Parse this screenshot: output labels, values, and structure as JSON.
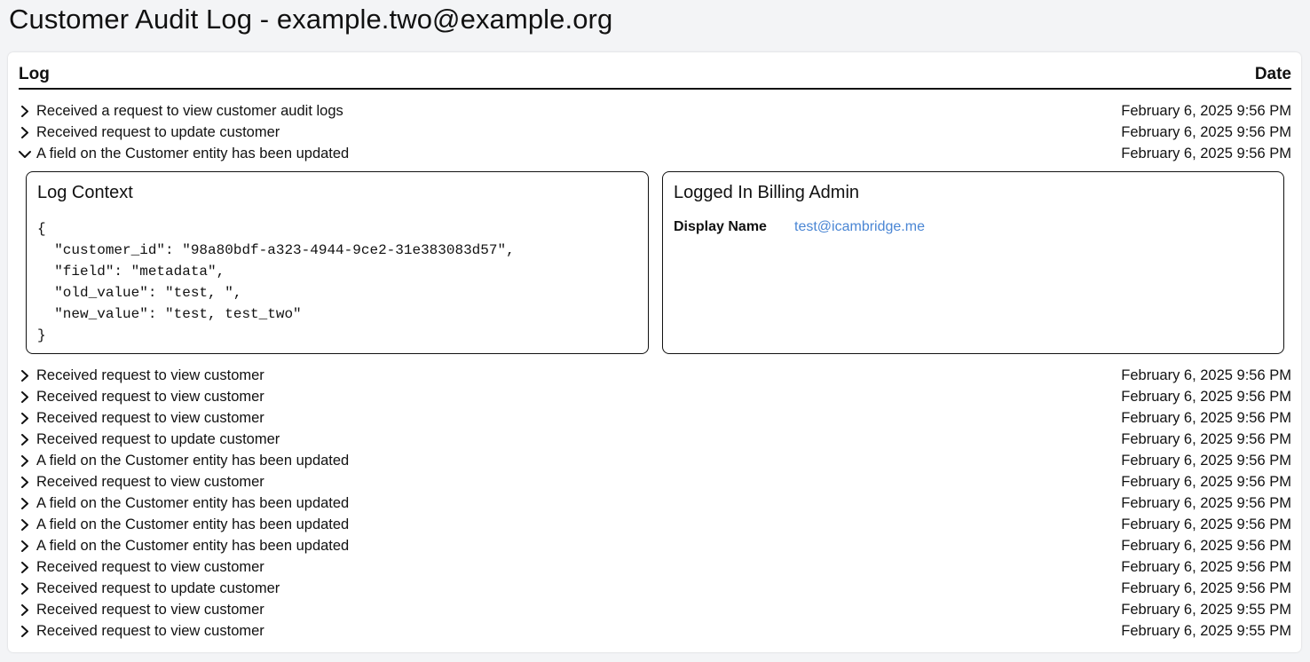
{
  "page": {
    "title": "Customer Audit Log - example.two@example.org"
  },
  "table": {
    "columns": {
      "log": "Log",
      "date": "Date"
    },
    "rows": [
      {
        "message": "Received a request to view customer audit logs",
        "date": "February 6, 2025 9:56 PM",
        "expanded": false
      },
      {
        "message": "Received request to update customer",
        "date": "February 6, 2025 9:56 PM",
        "expanded": false
      },
      {
        "message": "A field on the Customer entity has been updated",
        "date": "February 6, 2025 9:56 PM",
        "expanded": true
      },
      {
        "message": "Received request to view customer",
        "date": "February 6, 2025 9:56 PM",
        "expanded": false
      },
      {
        "message": "Received request to view customer",
        "date": "February 6, 2025 9:56 PM",
        "expanded": false
      },
      {
        "message": "Received request to view customer",
        "date": "February 6, 2025 9:56 PM",
        "expanded": false
      },
      {
        "message": "Received request to update customer",
        "date": "February 6, 2025 9:56 PM",
        "expanded": false
      },
      {
        "message": "A field on the Customer entity has been updated",
        "date": "February 6, 2025 9:56 PM",
        "expanded": false
      },
      {
        "message": "Received request to view customer",
        "date": "February 6, 2025 9:56 PM",
        "expanded": false
      },
      {
        "message": "A field on the Customer entity has been updated",
        "date": "February 6, 2025 9:56 PM",
        "expanded": false
      },
      {
        "message": "A field on the Customer entity has been updated",
        "date": "February 6, 2025 9:56 PM",
        "expanded": false
      },
      {
        "message": "A field on the Customer entity has been updated",
        "date": "February 6, 2025 9:56 PM",
        "expanded": false
      },
      {
        "message": "Received request to view customer",
        "date": "February 6, 2025 9:56 PM",
        "expanded": false
      },
      {
        "message": "Received request to update customer",
        "date": "February 6, 2025 9:56 PM",
        "expanded": false
      },
      {
        "message": "Received request to view customer",
        "date": "February 6, 2025 9:55 PM",
        "expanded": false
      },
      {
        "message": "Received request to view customer",
        "date": "February 6, 2025 9:55 PM",
        "expanded": false
      }
    ]
  },
  "detail": {
    "log_context": {
      "title": "Log Context",
      "json": "{\n  \"customer_id\": \"98a80bdf-a323-4944-9ce2-31e383083d57\",\n  \"field\": \"metadata\",\n  \"old_value\": \"test, \",\n  \"new_value\": \"test, test_two\"\n}"
    },
    "admin": {
      "title": "Logged In Billing Admin",
      "display_name_label": "Display Name",
      "display_name_value": "test@icambridge.me"
    }
  },
  "colors": {
    "page_background": "#f3f4f6",
    "card_background": "#ffffff",
    "link": "#4a86d4",
    "text": "#111111"
  },
  "icons": {
    "collapsed": "chevron-right-icon",
    "expanded": "chevron-down-icon"
  }
}
